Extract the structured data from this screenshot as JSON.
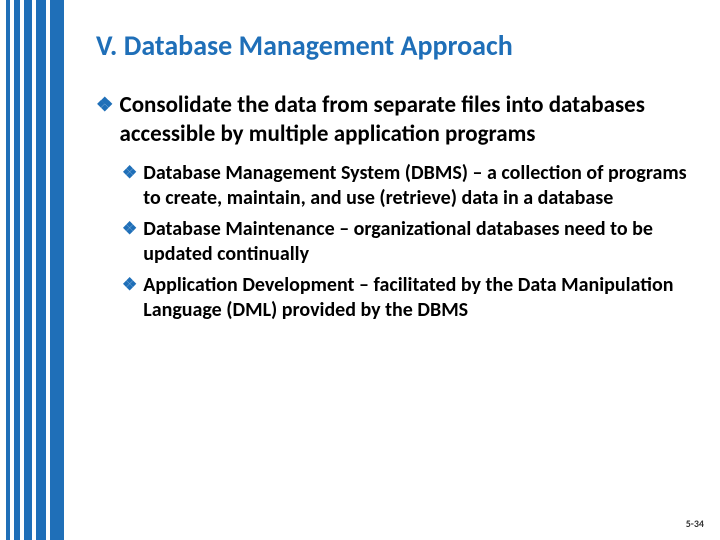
{
  "title": "V. Database Management Approach",
  "bullets": {
    "l1_0": "Consolidate the data from separate files into databases accessible by multiple application programs",
    "l2_0": "Database Management System (DBMS) – a collection of programs to create, maintain, and use (retrieve) data in a database",
    "l2_1": "Database Maintenance – organizational databases need to be updated continually",
    "l2_2": "Application Development – facilitated by the Data Manipulation Language (DML) provided by the DBMS"
  },
  "page_number": "5-34",
  "bullet_glyph": "❖"
}
